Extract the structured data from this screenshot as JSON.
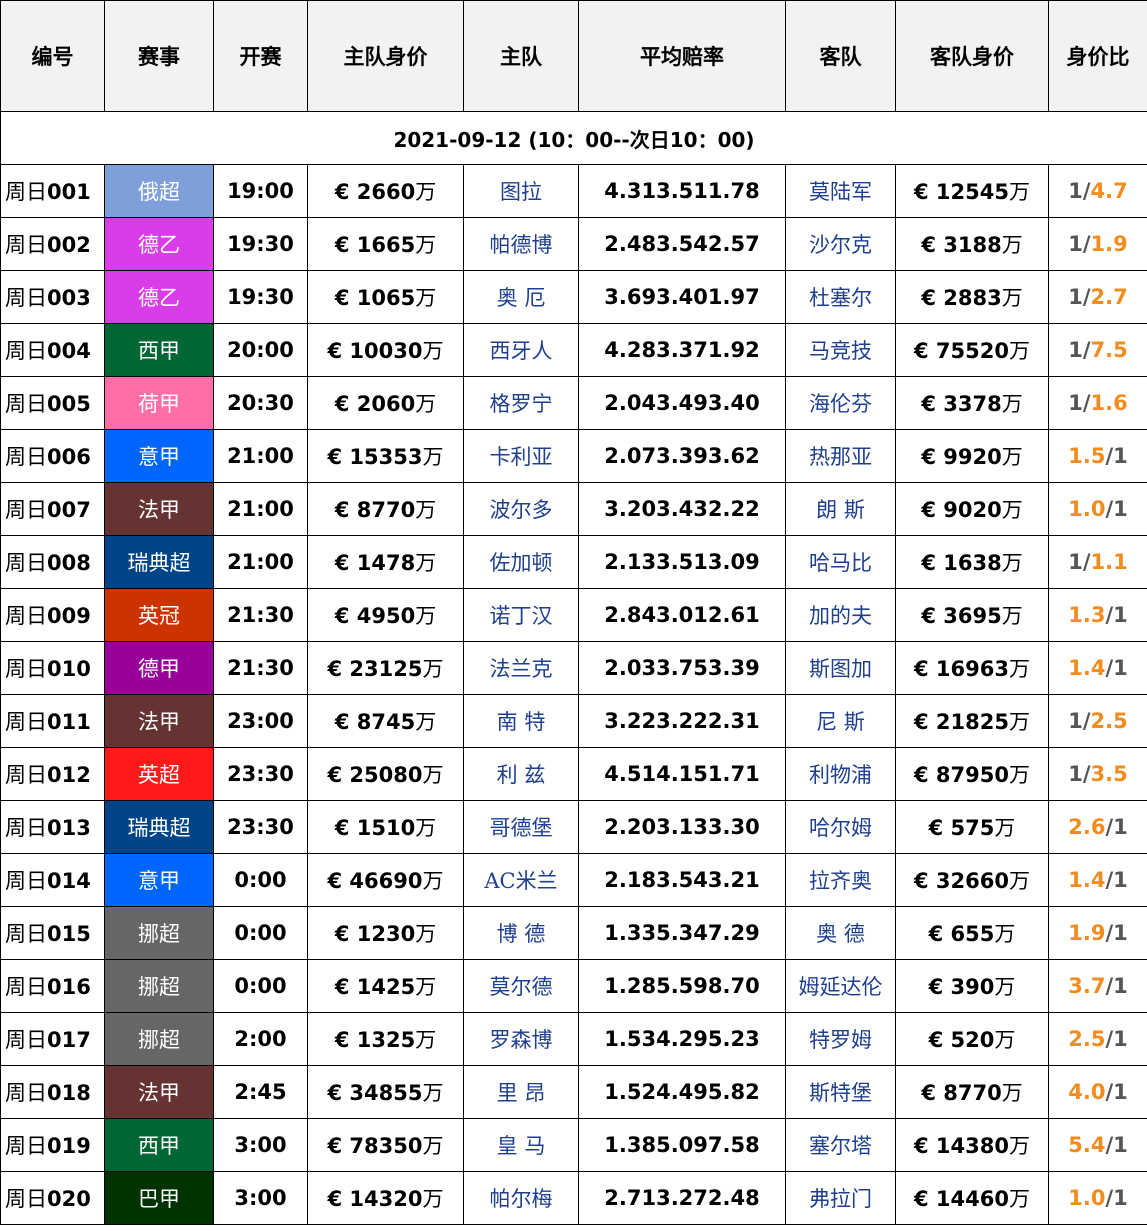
{
  "header": {
    "columns": [
      "编号",
      "赛事",
      "开赛",
      "主队身价",
      "主队",
      "平均赔率",
      "客队",
      "客队身价",
      "身价比"
    ]
  },
  "date_line": "2021-09-12 (10：00--次日10：00)",
  "matches": [
    {
      "id_prefix": "周日",
      "id_num": "001",
      "league": "俄超",
      "league_color": "#7f9fdb",
      "time": "19:00",
      "home_value": "€ 2660",
      "unit": "万",
      "home": "图拉",
      "odds": "4.313.511.78",
      "away": "莫陆军",
      "away_value": "€ 12545",
      "ratio_left": "1",
      "ratio_right": "4.7",
      "ratio_hi": "right"
    },
    {
      "id_prefix": "周日",
      "id_num": "002",
      "league": "德乙",
      "league_color": "#d93de8",
      "time": "19:30",
      "home_value": "€ 1665",
      "unit": "万",
      "home": "帕德博",
      "odds": "2.483.542.57",
      "away": "沙尔克",
      "away_value": "€ 3188",
      "ratio_left": "1",
      "ratio_right": "1.9",
      "ratio_hi": "right"
    },
    {
      "id_prefix": "周日",
      "id_num": "003",
      "league": "德乙",
      "league_color": "#d93de8",
      "time": "19:30",
      "home_value": "€ 1065",
      "unit": "万",
      "home": "奥 厄",
      "odds": "3.693.401.97",
      "away": "杜塞尔",
      "away_value": "€ 2883",
      "ratio_left": "1",
      "ratio_right": "2.7",
      "ratio_hi": "right"
    },
    {
      "id_prefix": "周日",
      "id_num": "004",
      "league": "西甲",
      "league_color": "#006633",
      "time": "20:00",
      "home_value": "€ 10030",
      "unit": "万",
      "home": "西牙人",
      "odds": "4.283.371.92",
      "away": "马竞技",
      "away_value": "€ 75520",
      "ratio_left": "1",
      "ratio_right": "7.5",
      "ratio_hi": "right"
    },
    {
      "id_prefix": "周日",
      "id_num": "005",
      "league": "荷甲",
      "league_color": "#ff6ea8",
      "time": "20:30",
      "home_value": "€ 2060",
      "unit": "万",
      "home": "格罗宁",
      "odds": "2.043.493.40",
      "away": "海伦芬",
      "away_value": "€ 3378",
      "ratio_left": "1",
      "ratio_right": "1.6",
      "ratio_hi": "right"
    },
    {
      "id_prefix": "周日",
      "id_num": "006",
      "league": "意甲",
      "league_color": "#0066ff",
      "time": "21:00",
      "home_value": "€ 15353",
      "unit": "万",
      "home": "卡利亚",
      "odds": "2.073.393.62",
      "away": "热那亚",
      "away_value": "€ 9920",
      "ratio_left": "1.5",
      "ratio_right": "1",
      "ratio_hi": "left"
    },
    {
      "id_prefix": "周日",
      "id_num": "007",
      "league": "法甲",
      "league_color": "#663333",
      "time": "21:00",
      "home_value": "€ 8770",
      "unit": "万",
      "home": "波尔多",
      "odds": "3.203.432.22",
      "away": "朗 斯",
      "away_value": "€ 9020",
      "ratio_left": "1.0",
      "ratio_right": "1",
      "ratio_hi": "left"
    },
    {
      "id_prefix": "周日",
      "id_num": "008",
      "league": "瑞典超",
      "league_color": "#004488",
      "time": "21:00",
      "home_value": "€ 1478",
      "unit": "万",
      "home": "佐加顿",
      "odds": "2.133.513.09",
      "away": "哈马比",
      "away_value": "€ 1638",
      "ratio_left": "1",
      "ratio_right": "1.1",
      "ratio_hi": "right"
    },
    {
      "id_prefix": "周日",
      "id_num": "009",
      "league": "英冠",
      "league_color": "#cc3300",
      "time": "21:30",
      "home_value": "€ 4950",
      "unit": "万",
      "home": "诺丁汉",
      "odds": "2.843.012.61",
      "away": "加的夫",
      "away_value": "€ 3695",
      "ratio_left": "1.3",
      "ratio_right": "1",
      "ratio_hi": "left"
    },
    {
      "id_prefix": "周日",
      "id_num": "010",
      "league": "德甲",
      "league_color": "#990099",
      "time": "21:30",
      "home_value": "€ 23125",
      "unit": "万",
      "home": "法兰克",
      "odds": "2.033.753.39",
      "away": "斯图加",
      "away_value": "€ 16963",
      "ratio_left": "1.4",
      "ratio_right": "1",
      "ratio_hi": "left"
    },
    {
      "id_prefix": "周日",
      "id_num": "011",
      "league": "法甲",
      "league_color": "#663333",
      "time": "23:00",
      "home_value": "€ 8745",
      "unit": "万",
      "home": "南 特",
      "odds": "3.223.222.31",
      "away": "尼 斯",
      "away_value": "€ 21825",
      "ratio_left": "1",
      "ratio_right": "2.5",
      "ratio_hi": "right"
    },
    {
      "id_prefix": "周日",
      "id_num": "012",
      "league": "英超",
      "league_color": "#ff1a1a",
      "time": "23:30",
      "home_value": "€ 25080",
      "unit": "万",
      "home": "利 兹",
      "odds": "4.514.151.71",
      "away": "利物浦",
      "away_value": "€ 87950",
      "ratio_left": "1",
      "ratio_right": "3.5",
      "ratio_hi": "right"
    },
    {
      "id_prefix": "周日",
      "id_num": "013",
      "league": "瑞典超",
      "league_color": "#004488",
      "time": "23:30",
      "home_value": "€ 1510",
      "unit": "万",
      "home": "哥德堡",
      "odds": "2.203.133.30",
      "away": "哈尔姆",
      "away_value": "€ 575",
      "ratio_left": "2.6",
      "ratio_right": "1",
      "ratio_hi": "left"
    },
    {
      "id_prefix": "周日",
      "id_num": "014",
      "league": "意甲",
      "league_color": "#0066ff",
      "time": "0:00",
      "home_value": "€ 46690",
      "unit": "万",
      "home": "AC米兰",
      "odds": "2.183.543.21",
      "away": "拉齐奥",
      "away_value": "€ 32660",
      "ratio_left": "1.4",
      "ratio_right": "1",
      "ratio_hi": "left"
    },
    {
      "id_prefix": "周日",
      "id_num": "015",
      "league": "挪超",
      "league_color": "#666666",
      "time": "0:00",
      "home_value": "€ 1230",
      "unit": "万",
      "home": "博 德",
      "odds": "1.335.347.29",
      "away": "奥 德",
      "away_value": "€ 655",
      "ratio_left": "1.9",
      "ratio_right": "1",
      "ratio_hi": "left"
    },
    {
      "id_prefix": "周日",
      "id_num": "016",
      "league": "挪超",
      "league_color": "#666666",
      "time": "0:00",
      "home_value": "€ 1425",
      "unit": "万",
      "home": "莫尔德",
      "odds": "1.285.598.70",
      "away": "姆延达伦",
      "away_value": "€ 390",
      "ratio_left": "3.7",
      "ratio_right": "1",
      "ratio_hi": "left"
    },
    {
      "id_prefix": "周日",
      "id_num": "017",
      "league": "挪超",
      "league_color": "#666666",
      "time": "2:00",
      "home_value": "€ 1325",
      "unit": "万",
      "home": "罗森博",
      "odds": "1.534.295.23",
      "away": "特罗姆",
      "away_value": "€ 520",
      "ratio_left": "2.5",
      "ratio_right": "1",
      "ratio_hi": "left"
    },
    {
      "id_prefix": "周日",
      "id_num": "018",
      "league": "法甲",
      "league_color": "#663333",
      "time": "2:45",
      "home_value": "€ 34855",
      "unit": "万",
      "home": "里 昂",
      "odds": "1.524.495.82",
      "away": "斯特堡",
      "away_value": "€ 8770",
      "ratio_left": "4.0",
      "ratio_right": "1",
      "ratio_hi": "left"
    },
    {
      "id_prefix": "周日",
      "id_num": "019",
      "league": "西甲",
      "league_color": "#006633",
      "time": "3:00",
      "home_value": "€ 78350",
      "unit": "万",
      "home": "皇 马",
      "odds": "1.385.097.58",
      "away": "塞尔塔",
      "away_value": "€ 14380",
      "ratio_left": "5.4",
      "ratio_right": "1",
      "ratio_hi": "left"
    },
    {
      "id_prefix": "周日",
      "id_num": "020",
      "league": "巴甲",
      "league_color": "#003300",
      "time": "3:00",
      "home_value": "€ 14320",
      "unit": "万",
      "home": "帕尔梅",
      "odds": "2.713.272.48",
      "away": "弗拉门",
      "away_value": "€ 14460",
      "ratio_left": "1.0",
      "ratio_right": "1",
      "ratio_hi": "left"
    }
  ],
  "colors": {
    "ratio_highlight": "#f28c1e",
    "ratio_plain": "#555555",
    "team_text": "#1f3f8f",
    "header_bg": "#f2f2f2"
  }
}
